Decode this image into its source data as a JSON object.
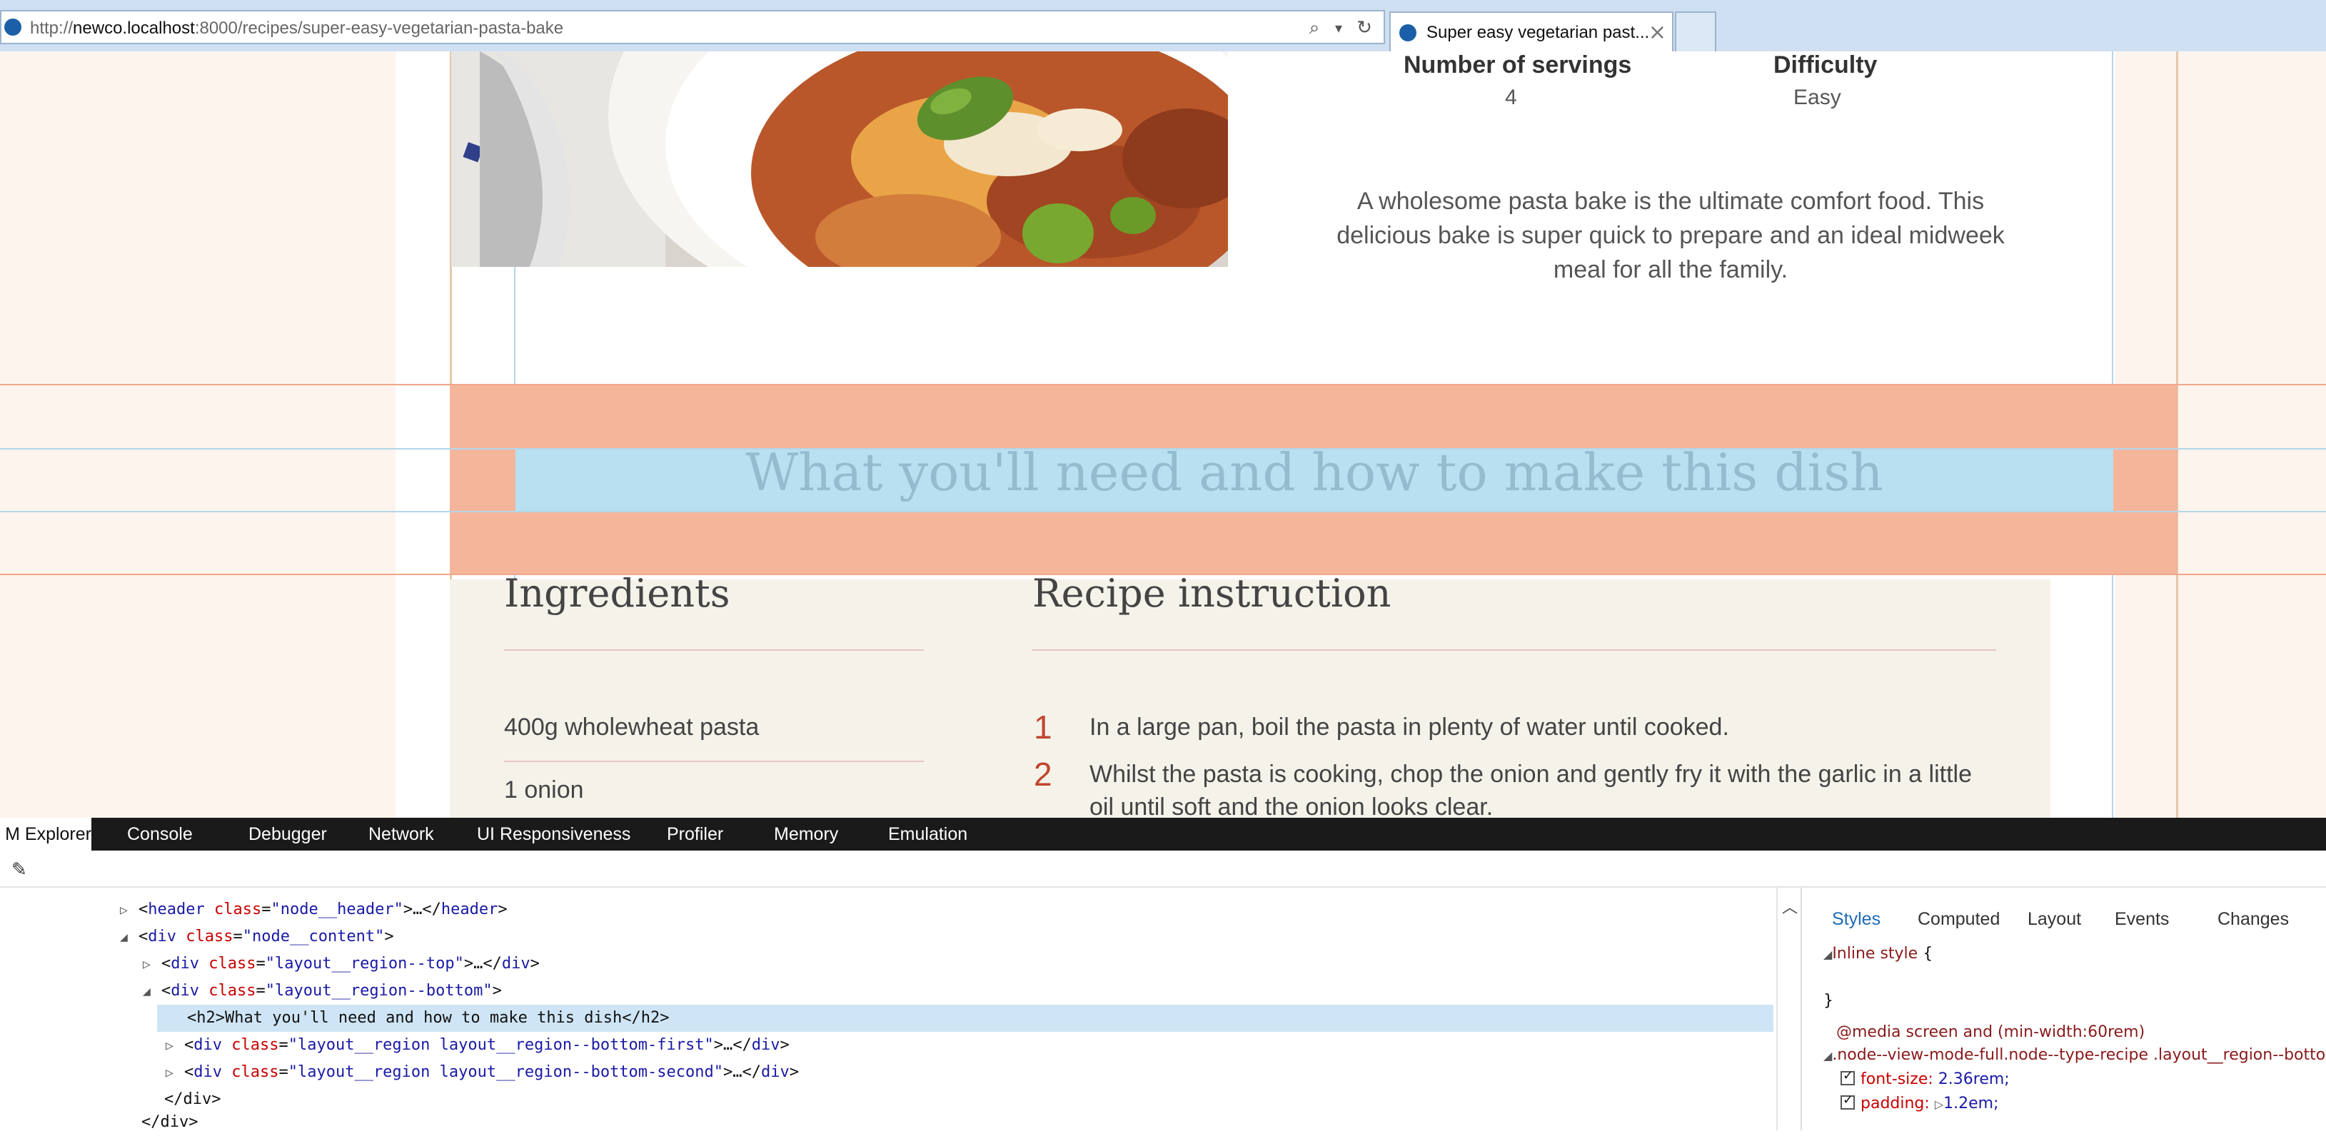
{
  "browser": {
    "url_prefix": "http://",
    "url_host": "newco.localhost",
    "url_rest": ":8000/recipes/super-easy-vegetarian-pasta-bake",
    "tab_title": "Super easy vegetarian past...",
    "tab_close": "×",
    "search_glyph": "⌕",
    "dropdown_glyph": "▾",
    "refresh_glyph": "↻"
  },
  "recipe": {
    "servings_label": "Number of servings",
    "servings_value": "4",
    "difficulty_label": "Difficulty",
    "difficulty_value": "Easy",
    "intro": "A wholesome pasta bake is the ultimate comfort food. This delicious bake is super quick to prepare and an ideal midweek meal for all the family.",
    "section_heading": "What you'll need and how to make this dish",
    "ingredients_title": "Ingredients",
    "ingredients": [
      "400g wholewheat pasta",
      "1 onion"
    ],
    "instructions_title": "Recipe instruction",
    "steps": [
      {
        "num": "1",
        "text": "In a large pan, boil the pasta in plenty of water until cooked."
      },
      {
        "num": "2",
        "text": "Whilst the pasta is cooking, chop the onion and gently fry it with the garlic in a little",
        "text2": "oil until soft and the onion looks clear."
      }
    ]
  },
  "devtools": {
    "tabs": [
      "M Explorer",
      "Console",
      "Debugger",
      "Network",
      "UI Responsiveness",
      "Profiler",
      "Memory",
      "Emulation"
    ],
    "dom": [
      {
        "open": "<",
        "tag": "header",
        "attr": "class",
        "val": "\"node__header\"",
        "tail": ">…</",
        "close": "header",
        "end": ">"
      },
      {
        "open": "<",
        "tag": "div",
        "attr": "class",
        "val": "\"node__content\"",
        "tail": ">",
        "close": "",
        "end": ""
      },
      {
        "open": "<",
        "tag": "div",
        "attr": "class",
        "val": "\"layout__region--top\"",
        "tail": ">…</",
        "close": "div",
        "end": ">"
      },
      {
        "open": "<",
        "tag": "div",
        "attr": "class",
        "val": "\"layout__region--bottom\"",
        "tail": ">",
        "close": "",
        "end": ""
      },
      {
        "plain": "<h2>What you'll need and how to make this dish</h2>"
      },
      {
        "open": "<",
        "tag": "div",
        "attr": "class",
        "val": "\"layout__region layout__region--bottom-first\"",
        "tail": ">…</",
        "close": "div",
        "end": ">"
      },
      {
        "open": "<",
        "tag": "div",
        "attr": "class",
        "val": "\"layout__region layout__region--bottom-second\"",
        "tail": ">…</",
        "close": "div",
        "end": ">"
      },
      {
        "plain": "</div>"
      },
      {
        "plain": "</div>"
      }
    ],
    "style_tabs": [
      "Styles",
      "Computed",
      "Layout",
      "Events",
      "Changes"
    ],
    "inline_style": "Inline style",
    "brace_open": "{",
    "brace_close": "}",
    "media": "@media screen and (min-width:60rem)",
    "rule_selector": "node--view-mode-full.node--type-recipe .layout__region--bottom",
    "props": [
      {
        "name": "font-size:",
        "value": "2.36rem;"
      },
      {
        "name": "padding:",
        "value": "1.2em;"
      }
    ]
  }
}
